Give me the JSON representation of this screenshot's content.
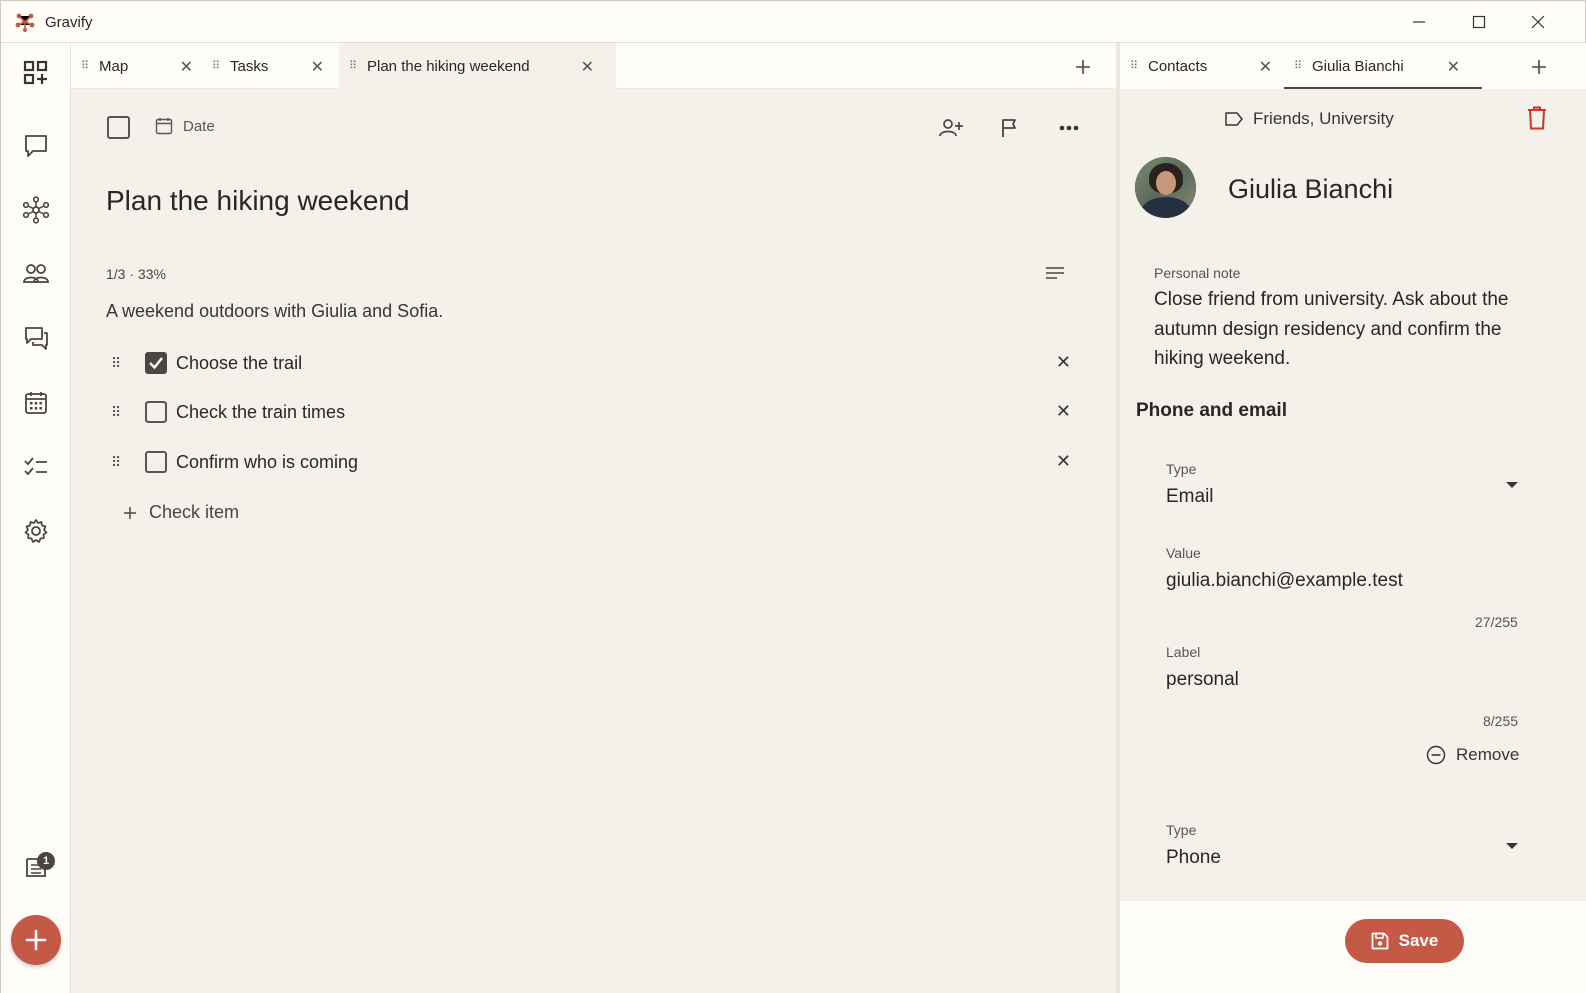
{
  "app": {
    "title": "Gravify"
  },
  "colors": {
    "accent": "#c45a45",
    "background": "#f4f0ea",
    "surface": "#fffdf8",
    "text": "#2b2622"
  },
  "sidebar": {
    "icons": [
      "dashboard-add-icon",
      "chat-bubble-icon",
      "network-graph-icon",
      "people-icon",
      "conversations-icon",
      "calendar-icon",
      "checklist-icon",
      "settings-icon",
      "notes-icon"
    ],
    "notes_badge": "1"
  },
  "left_tabs": [
    {
      "label": "Map"
    },
    {
      "label": "Tasks"
    },
    {
      "label": "Plan the hiking weekend",
      "active": true
    }
  ],
  "right_tabs": [
    {
      "label": "Contacts"
    },
    {
      "label": "Giulia Bianchi",
      "active": true
    }
  ],
  "task": {
    "date_label": "Date",
    "title": "Plan the hiking weekend",
    "progress": "1/3 · 33%",
    "description": "A weekend outdoors with Giulia and Sofia.",
    "checklist": [
      {
        "label": "Choose the trail",
        "checked": true
      },
      {
        "label": "Check the train times",
        "checked": false
      },
      {
        "label": "Confirm who is coming",
        "checked": false
      }
    ],
    "add_check_label": "Check item"
  },
  "contact": {
    "tags": "Friends, University",
    "name": "Giulia Bianchi",
    "note_label": "Personal note",
    "note": "Close friend from university. Ask about the autumn design residency and confirm the hiking weekend.",
    "section_title": "Phone and email",
    "entries": [
      {
        "type_label": "Type",
        "type": "Email",
        "value_label": "Value",
        "value": "giulia.bianchi@example.test",
        "value_counter": "27/255",
        "label_label": "Label",
        "label": "personal",
        "label_counter": "8/255",
        "remove_label": "Remove"
      },
      {
        "type_label": "Type",
        "type": "Phone"
      }
    ],
    "save_label": "Save"
  }
}
